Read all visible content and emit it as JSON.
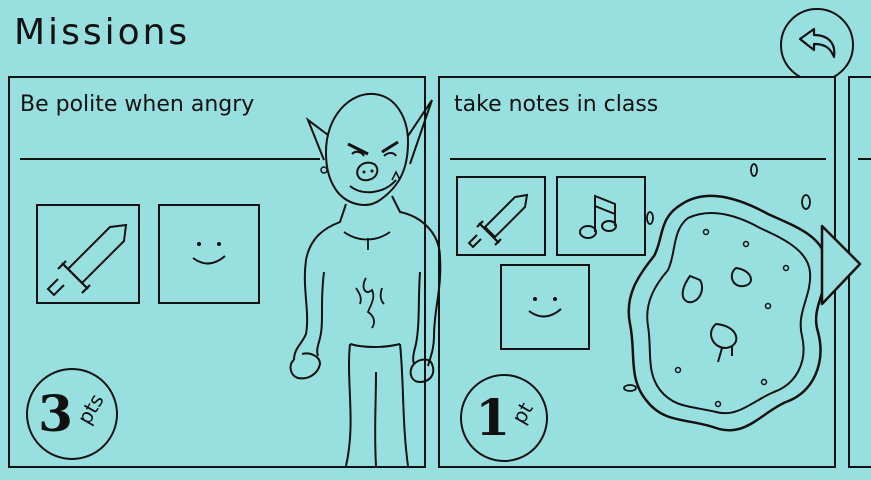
{
  "screen": {
    "title": "Missions"
  },
  "back_button": {
    "icon": "undo-arrow-icon"
  },
  "missions": [
    {
      "title": "Be polite when angry",
      "rewards": [
        "sword-icon",
        "smiley-icon"
      ],
      "points": "3",
      "points_unit": "pts"
    },
    {
      "title": "take notes in class",
      "rewards": [
        "sword-icon",
        "music-note-icon",
        "smiley-icon"
      ],
      "points": "1",
      "points_unit": "pt"
    }
  ],
  "colors": {
    "background": "#98e0e0",
    "ink": "#111111"
  }
}
